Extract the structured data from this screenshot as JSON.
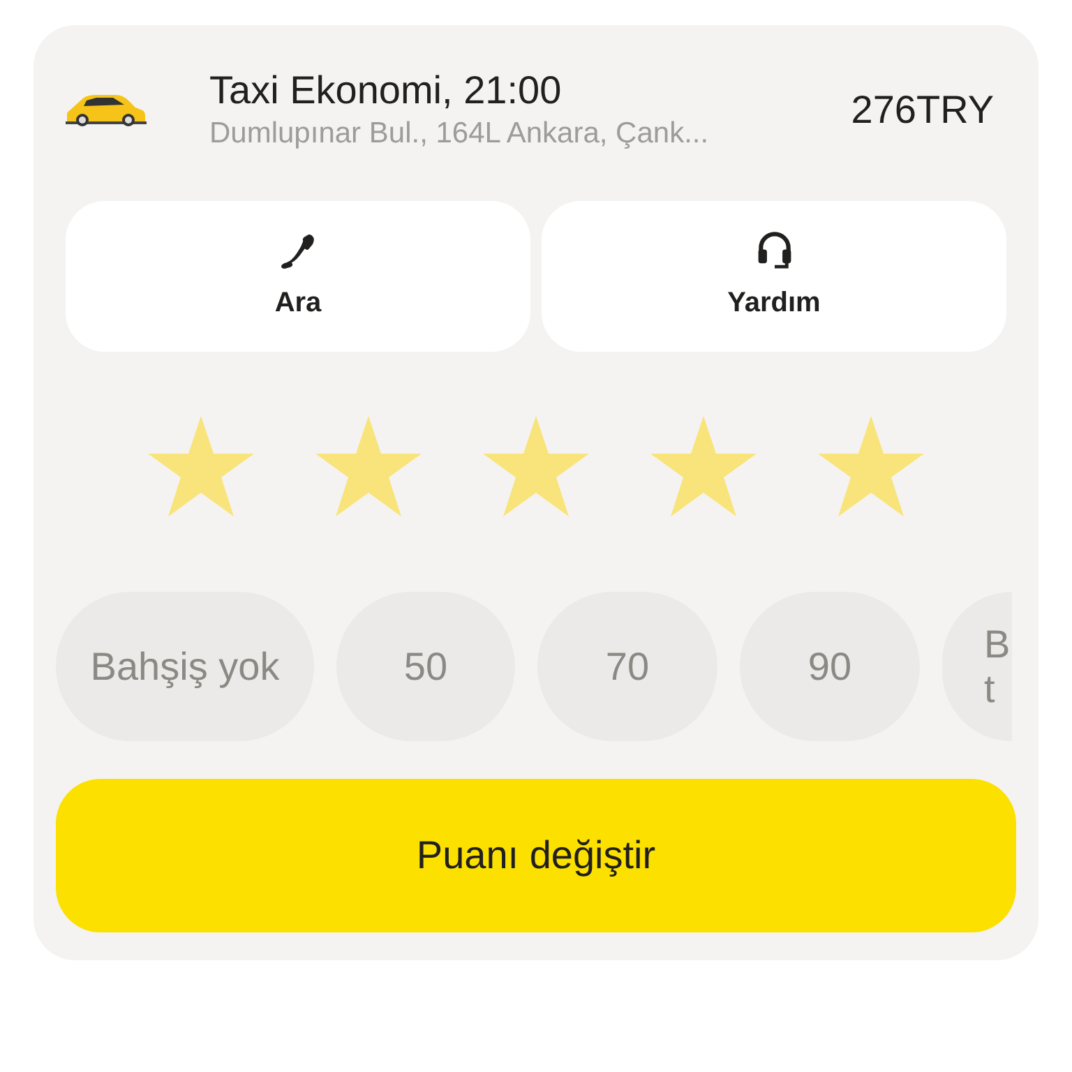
{
  "order": {
    "title": "Taxi Ekonomi, 21:00",
    "address": "Dumlupınar Bul., 164L Ankara, Çank...",
    "price": "276TRY"
  },
  "actions": [
    {
      "kind": "call",
      "label": "Ara"
    },
    {
      "kind": "support",
      "label": "Yardım"
    }
  ],
  "rating": {
    "stars": 5
  },
  "tips": [
    {
      "label": "Bahşiş yok",
      "selected": false
    },
    {
      "label": "50",
      "selected": false
    },
    {
      "label": "70",
      "selected": false
    },
    {
      "label": "90",
      "selected": false
    },
    {
      "label": "B t",
      "selected": false,
      "kind": "partial"
    }
  ],
  "submit_button": "Puanı değiştir"
}
